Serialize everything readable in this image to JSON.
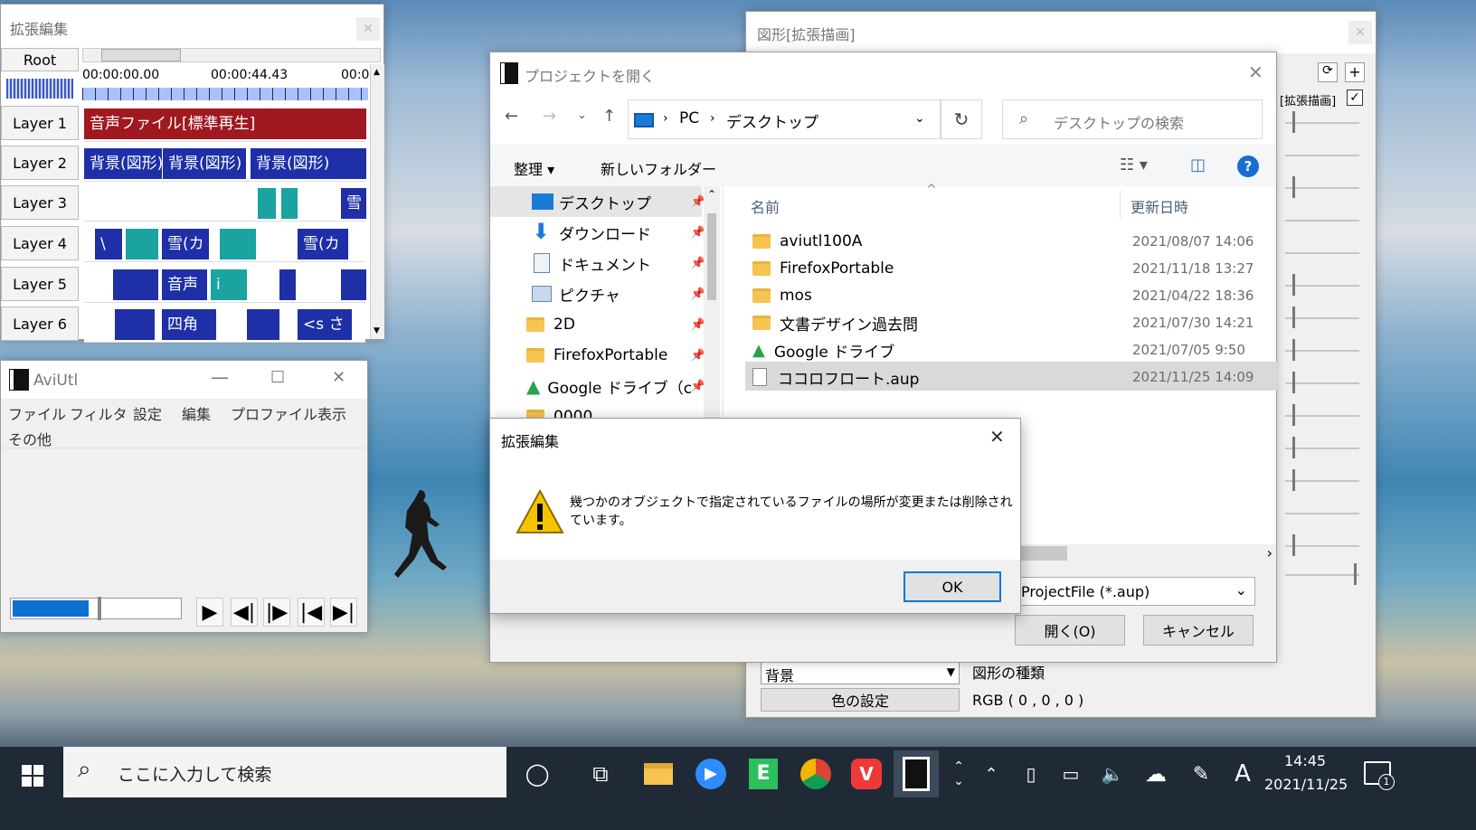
{
  "ext_edit": {
    "title": "拡張編集",
    "root": "Root",
    "time_start": "00:00:00.00",
    "time_mid": "00:00:44.43",
    "time_end": "00:0",
    "layers": [
      "Layer 1",
      "Layer 2",
      "Layer 3",
      "Layer 4",
      "Layer 5",
      "Layer 6"
    ],
    "clip_audio": "音声ファイル[標準再生]",
    "clip_bg1": "背景(図形)",
    "clip_bg2": "背景(図形)",
    "clip_bg3": "背景(図形)",
    "clip_snow3": "雪",
    "clip_snow4a": "雪(カ",
    "clip_snow4b": "雪(カ",
    "clip_v": "\\",
    "clip_audio5": "音声",
    "clip_five_small": "i",
    "clip_square": "四角",
    "clip_s": "<s さ"
  },
  "aviutl": {
    "title": "AviUtl",
    "menu": [
      "ファイル",
      "フィルタ",
      "設定",
      "編集",
      "プロファイル",
      "表示",
      "その他"
    ]
  },
  "shape_window": {
    "title": "図形[拡張描画]",
    "check_label": "[拡張描画]",
    "shape_select": "背景",
    "shape_type_label": "図形の種類",
    "color_button": "色の設定",
    "rgb": "RGB ( 0 , 0 , 0 )"
  },
  "open_dialog": {
    "title": "プロジェクトを開く",
    "breadcrumb": [
      "PC",
      "デスクトップ"
    ],
    "search_placeholder": "デスクトップの検索",
    "organize": "整理",
    "new_folder": "新しいフォルダー",
    "nav_items": [
      "デスクトップ",
      "ダウンロード",
      "ドキュメント",
      "ピクチャ",
      "2D",
      "FirefoxPortable",
      "Google ドライブ（c",
      "0000"
    ],
    "col_name": "名前",
    "col_date": "更新日時",
    "files": [
      {
        "name": "aviutl100A",
        "date": "2021/08/07 14:06",
        "type": "folder"
      },
      {
        "name": "FirefoxPortable",
        "date": "2021/11/18 13:27",
        "type": "folder"
      },
      {
        "name": "mos",
        "date": "2021/04/22 18:36",
        "type": "folder"
      },
      {
        "name": "文書デザイン過去問",
        "date": "2021/07/30 14:21",
        "type": "folder"
      },
      {
        "name": "Google ドライブ",
        "date": "2021/07/05 9:50",
        "type": "gdrive"
      },
      {
        "name": "ココロフロート.aup",
        "date": "2021/11/25 14:09",
        "type": "file"
      }
    ],
    "filter": "ProjectFile (*.aup)",
    "open_button": "開く(O)",
    "cancel_button": "キャンセル"
  },
  "alert": {
    "title": "拡張編集",
    "message_line1": "幾つかのオブジェクトで指定されているファイルの場所が変更または削除され",
    "message_line2": "ています。",
    "ok": "OK"
  },
  "taskbar": {
    "search_placeholder": "ここに入力して検索",
    "time": "14:45",
    "date": "2021/11/25",
    "ime": "A",
    "notification_count": "1"
  }
}
